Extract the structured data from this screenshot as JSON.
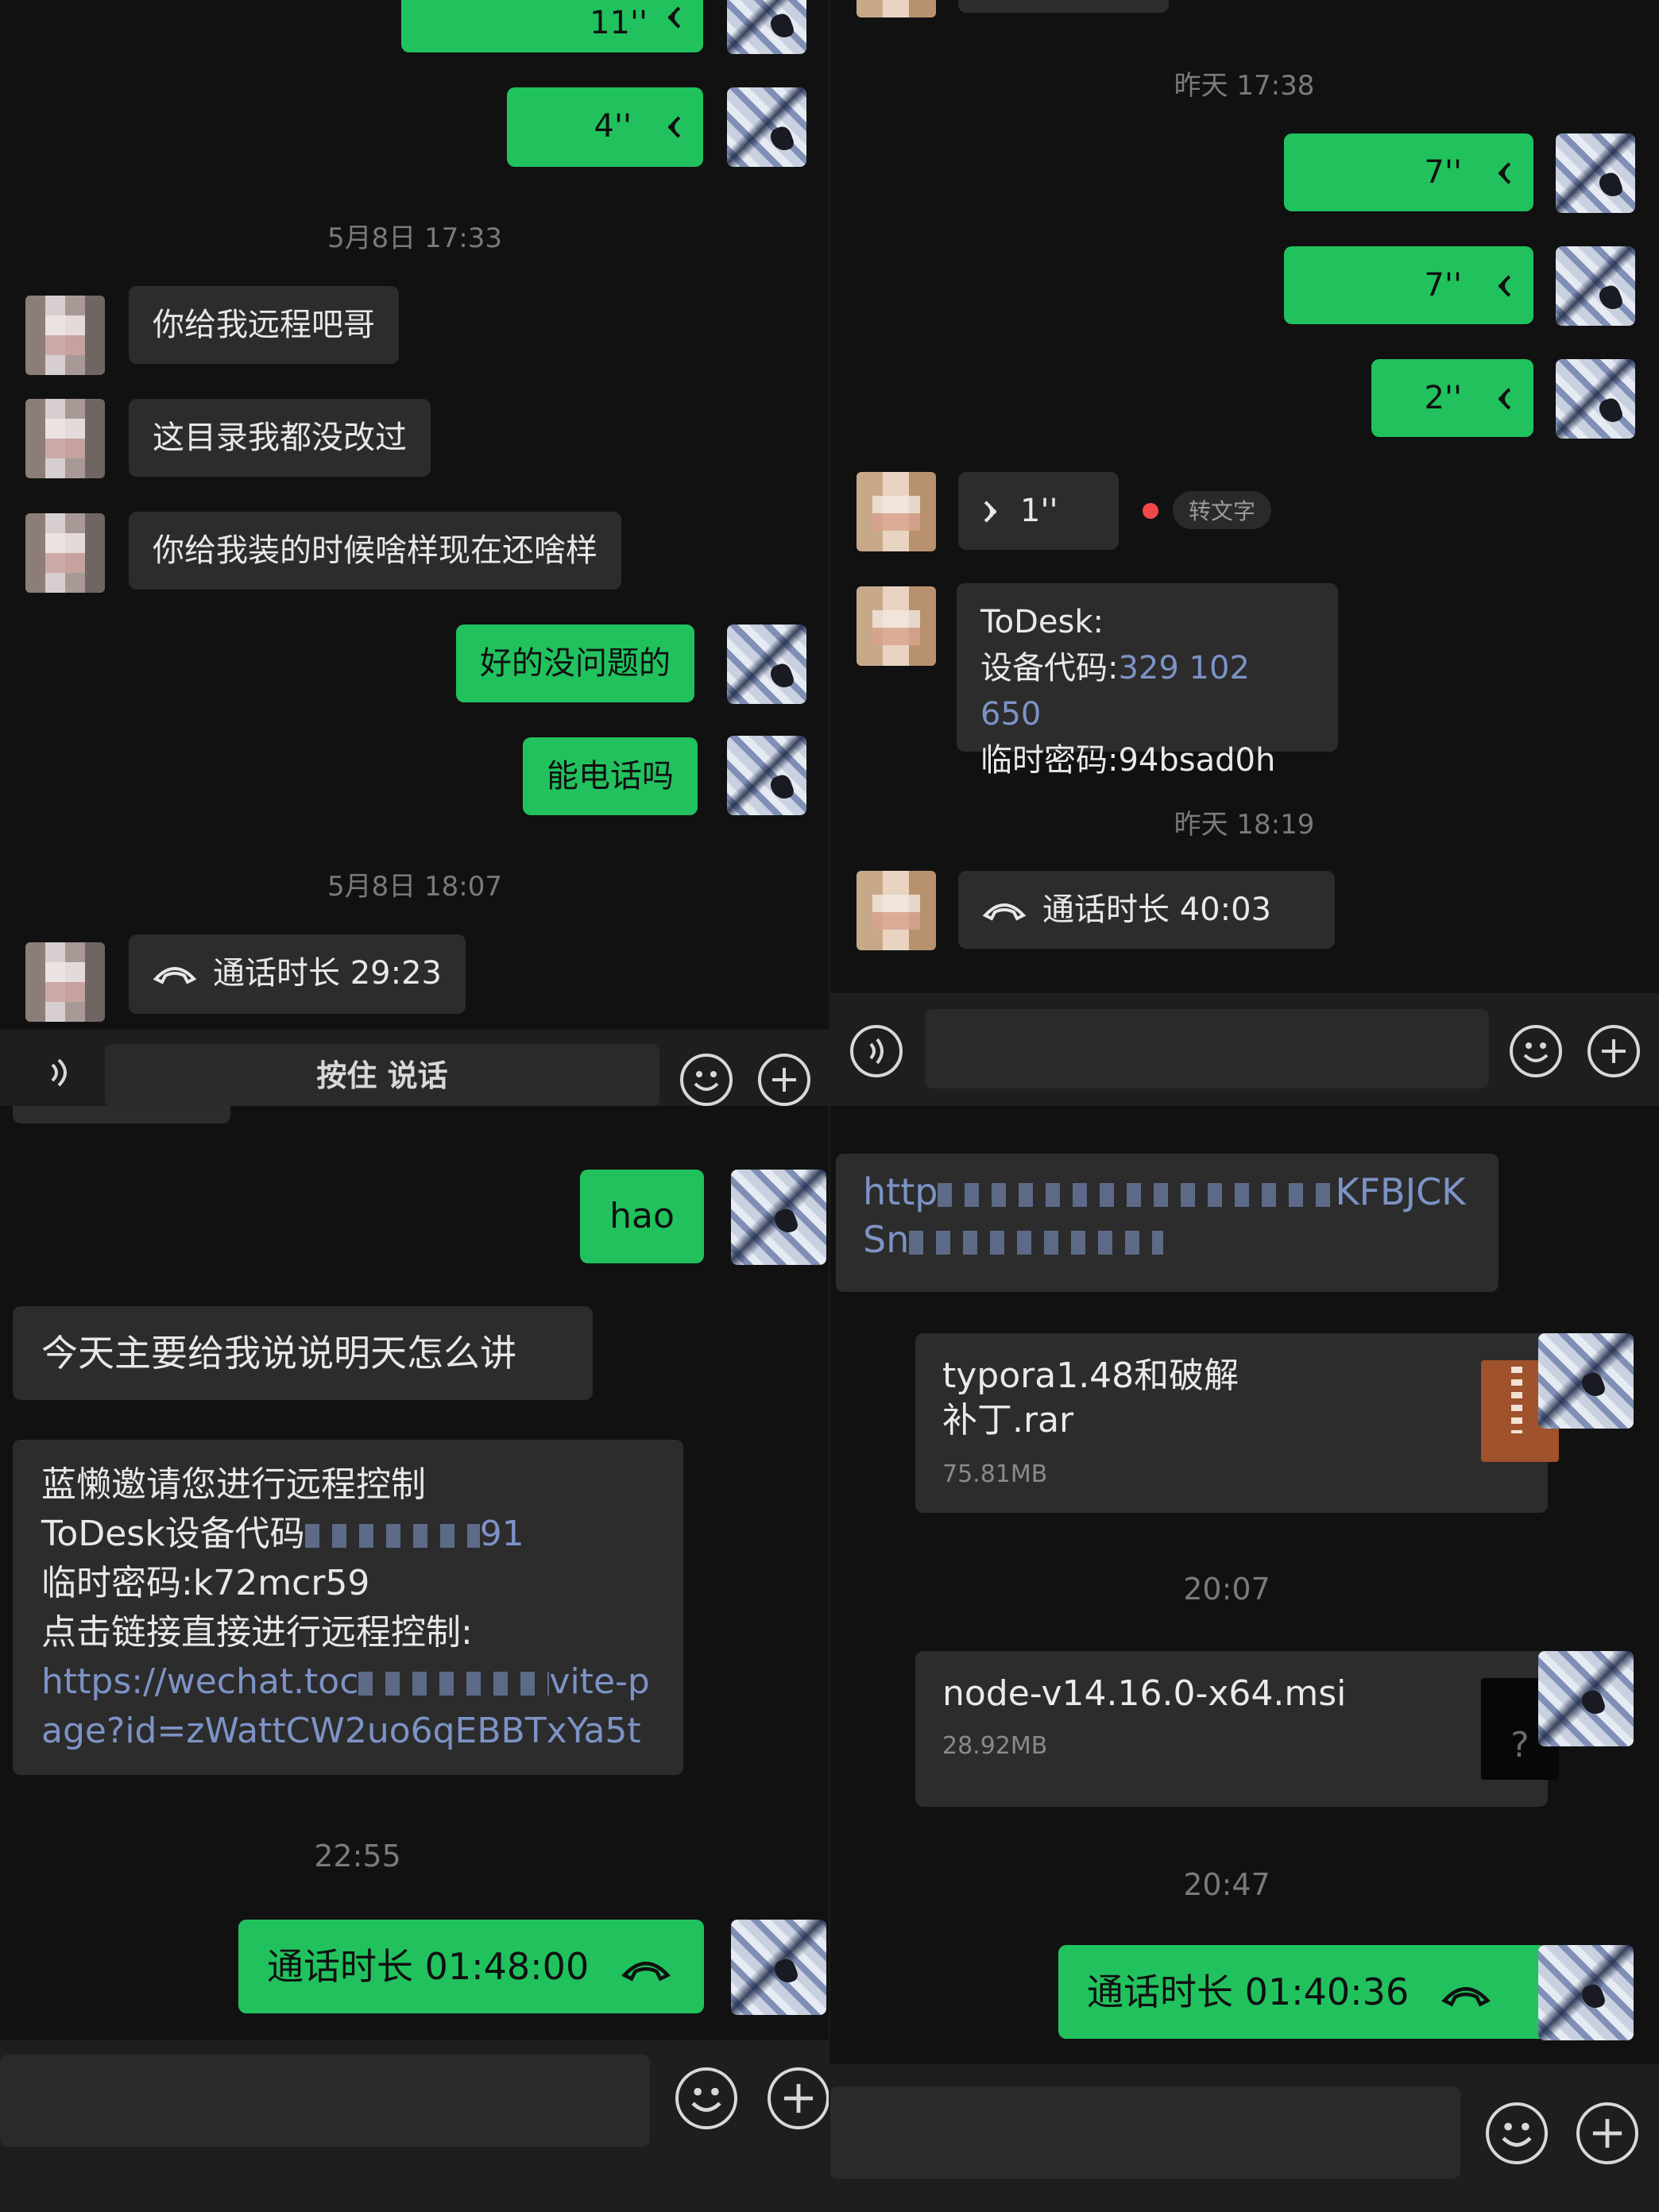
{
  "top_left": {
    "voice_1": "11''",
    "voice_2": "4''",
    "time_1": "5月8日 17:33",
    "msg_1": "你给我远程吧哥",
    "msg_2": "这目录我都没改过",
    "msg_3": "你给我装的时候啥样现在还啥样",
    "msg_4": "好的没问题的",
    "msg_5": "能电话吗",
    "time_2": "5月8日 18:07",
    "call": "通话时长 29:23",
    "hold_to_talk": "按住 说话"
  },
  "top_right": {
    "time_1": "昨天 17:38",
    "voice_1": "7''",
    "voice_2": "7''",
    "voice_3": "2''",
    "voice_in": "1''",
    "convert_text": "转文字",
    "todesk_title": "ToDesk:",
    "todesk_code_label": "设备代码:",
    "todesk_code": "329 102 650",
    "todesk_pwd": "临时密码:94bsad0h",
    "time_2": "昨天 18:19",
    "call": "通话时长 40:03"
  },
  "bottom_left": {
    "msg_hao": "hao",
    "msg_1": "今天主要给我说说明天怎么讲",
    "invite_line1": "蓝懒邀请您进行远程控制",
    "invite_line2_prefix": "ToDesk设备代码",
    "invite_line2_suffix": "91",
    "invite_line3": "临时密码:k72mcr59",
    "invite_line4": "点击链接直接进行远程控制:",
    "invite_link1_prefix": "https://wechat.toc",
    "invite_link1_suffix": "vite-p",
    "invite_link2": "age?id=zWattCW2uo6qEBBTxYa5t",
    "time_1": "22:55",
    "call": "通话时长 01:48:00"
  },
  "bottom_right": {
    "link_line1_prefix": "http",
    "link_line1_suffix": "KFBJCK",
    "link_line2_prefix": "Sn",
    "file1_name_line1": "typora1.48和破解",
    "file1_name_line2": "补丁.rar",
    "file1_size": "75.81MB",
    "time_1": "20:07",
    "file2_name": "node-v14.16.0-x64.msi",
    "file2_size": "28.92MB",
    "time_2": "20:47",
    "call": "通话时长 01:40:36"
  },
  "colors": {
    "background": "#111111",
    "bubble_green": "#21c25e",
    "bubble_gray": "#2c2c2c",
    "link": "#7d93c6",
    "archive_icon": "#a0522d"
  },
  "icons": [
    "voice-wave-icon",
    "phone-hangup-icon",
    "emoji-icon",
    "plus-icon",
    "voice-toggle-icon",
    "archive-file-icon",
    "unknown-file-icon"
  ]
}
